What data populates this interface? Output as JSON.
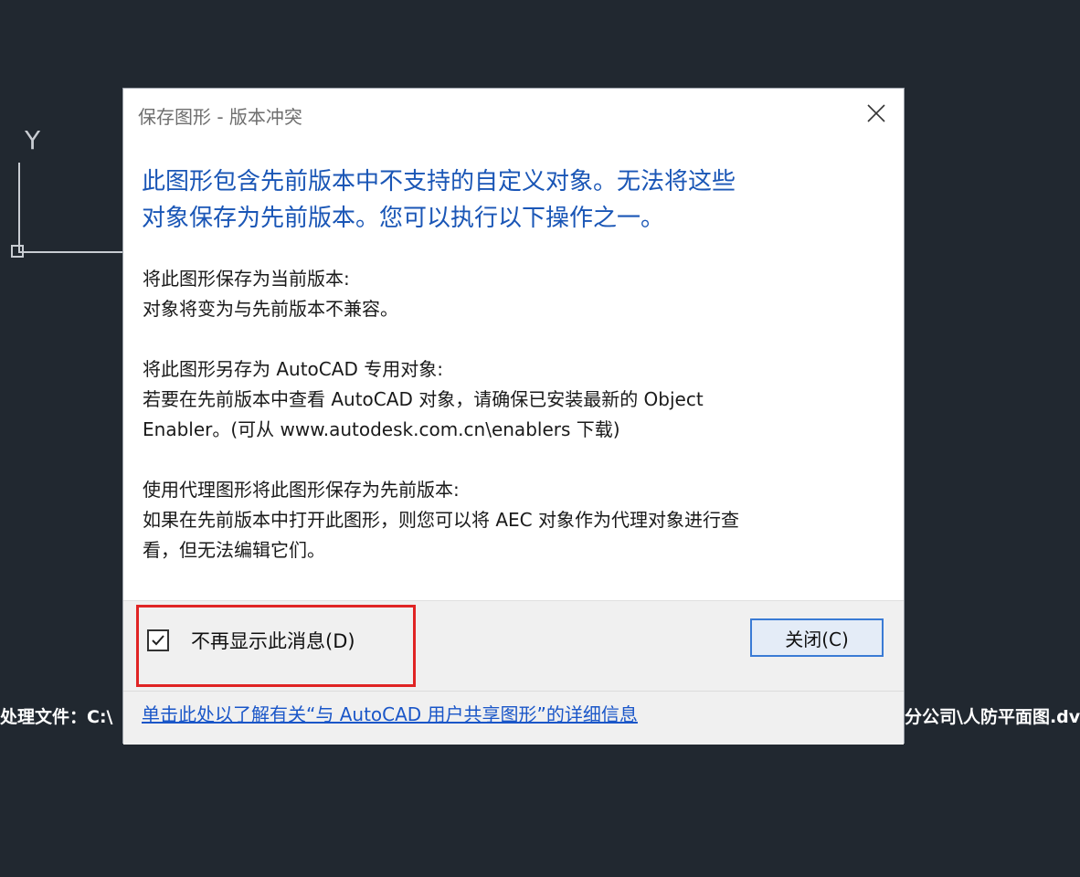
{
  "canvas": {
    "ucs_y_label": "Y",
    "command_line_left": "处理文件：C:\\",
    "command_line_right": "分公司\\人防平面图.dv"
  },
  "dialog": {
    "title": "保存图形 - 版本冲突",
    "heading_lines": [
      "此图形包含先前版本中不支持的自定义对象。无法将这些",
      "对象保存为先前版本。您可以执行以下操作之一。"
    ],
    "options": [
      {
        "line1": "将此图形保存为当前版本:",
        "line2": "对象将变为与先前版本不兼容。"
      },
      {
        "line1": "将此图形另存为 AutoCAD 专用对象:",
        "line2": "若要在先前版本中查看 AutoCAD 对象，请确保已安装最新的 Object",
        "line3": "Enabler。(可从 www.autodesk.com.cn\\enablers 下载)"
      },
      {
        "line1": "使用代理图形将此图形保存为先前版本:",
        "line2": "如果在先前版本中打开此图形，则您可以将 AEC 对象作为代理对象进行查",
        "line3": "看，但无法编辑它们。"
      }
    ],
    "checkbox_label": "不再显示此消息(D)",
    "checkbox_checked": true,
    "close_button_label": "关闭(C)",
    "help_link": "单击此处以了解有关“与 AutoCAD 用户共享图形”的详细信息"
  },
  "colors": {
    "background": "#212830",
    "heading": "#1a56b6",
    "link": "#1a56c8",
    "highlight": "#e02424",
    "button_border": "#3a7bd5"
  }
}
